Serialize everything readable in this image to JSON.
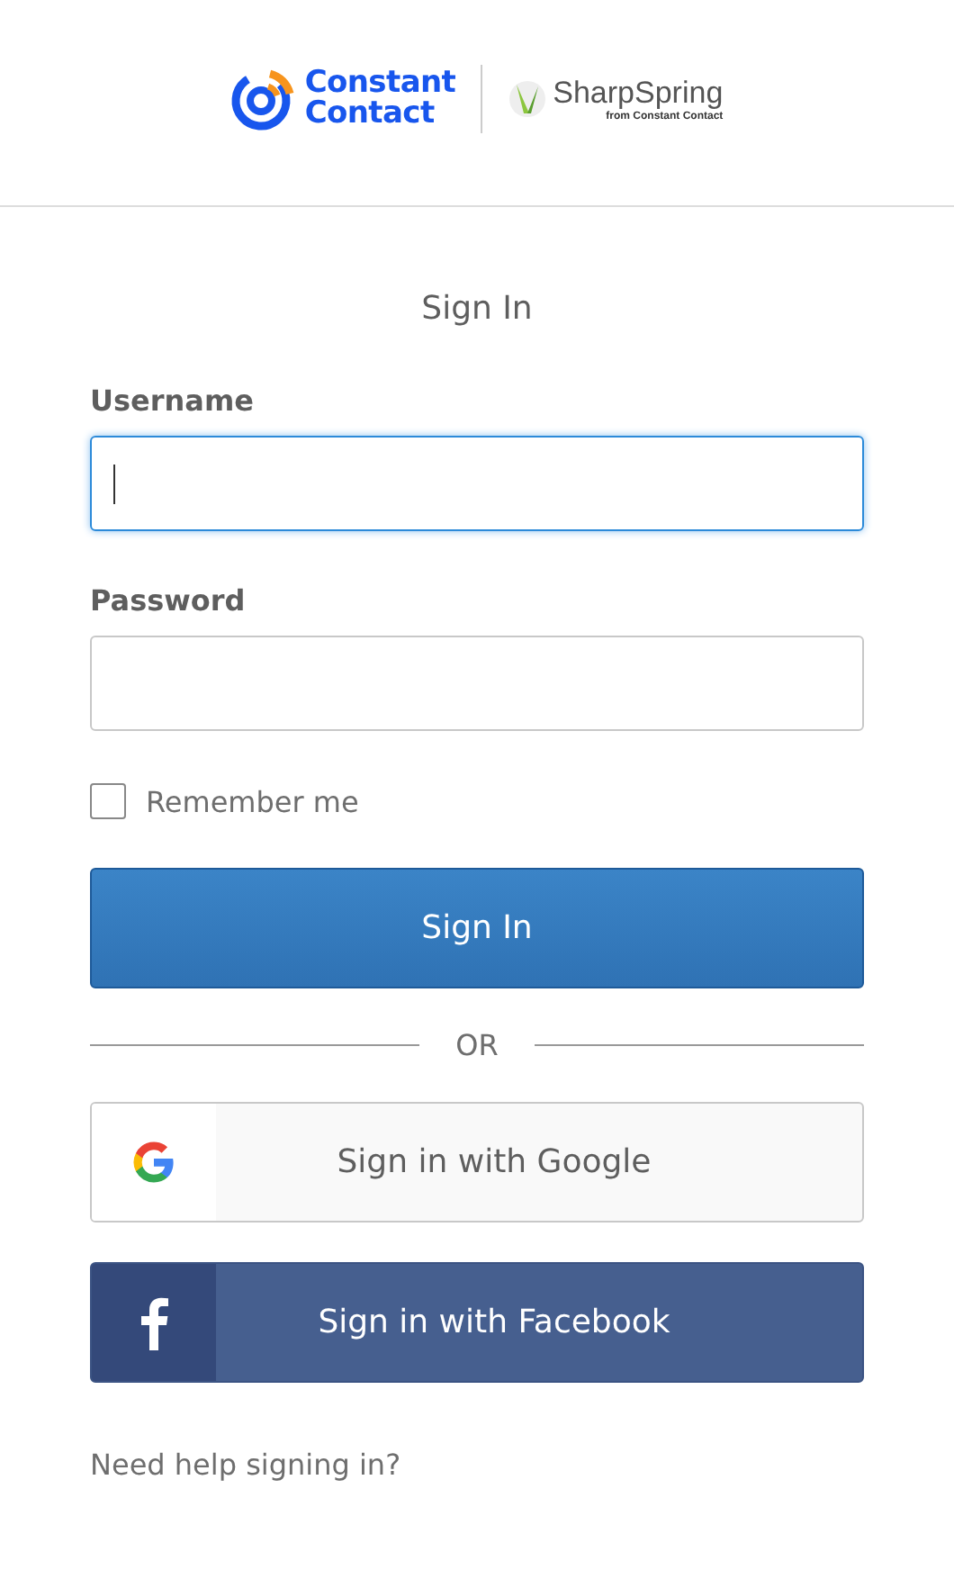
{
  "header": {
    "brand_primary": [
      "Constant",
      "Contact"
    ],
    "brand_secondary": "SharpSpring",
    "brand_secondary_tagline": "from Constant Contact"
  },
  "form": {
    "title": "Sign In",
    "fields": [
      {
        "label": "Username",
        "focused": true
      },
      {
        "label": "Password",
        "focused": false
      }
    ],
    "remember": {
      "label": "Remember me",
      "checked": false
    },
    "submit": "Sign In",
    "divider": "OR",
    "social": [
      {
        "kind": "google",
        "label": "Sign in with Google"
      },
      {
        "kind": "facebook",
        "label": "Sign in with Facebook"
      }
    ],
    "help_link": "Need help signing in?"
  }
}
